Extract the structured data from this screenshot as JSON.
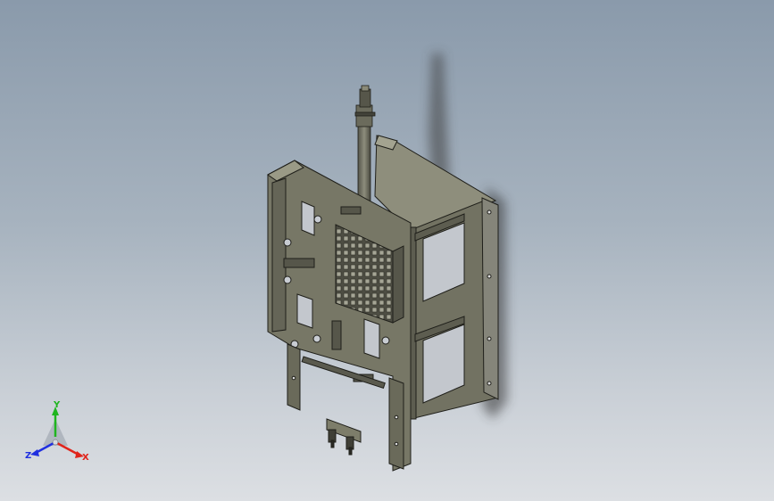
{
  "viewport": {
    "background_top": "#8a9aab",
    "background_bottom": "#dcdfe3"
  },
  "model": {
    "part_color": "#6f6f60",
    "part_highlight": "#9b9b88",
    "edge_color": "#1f1f1a",
    "shadow_color": "#2a2a2a"
  },
  "triad": {
    "x_label": "X",
    "y_label": "Y",
    "z_label": "Z",
    "x_color": "#e0241b",
    "y_color": "#1fb51f",
    "z_color": "#2030e0"
  }
}
